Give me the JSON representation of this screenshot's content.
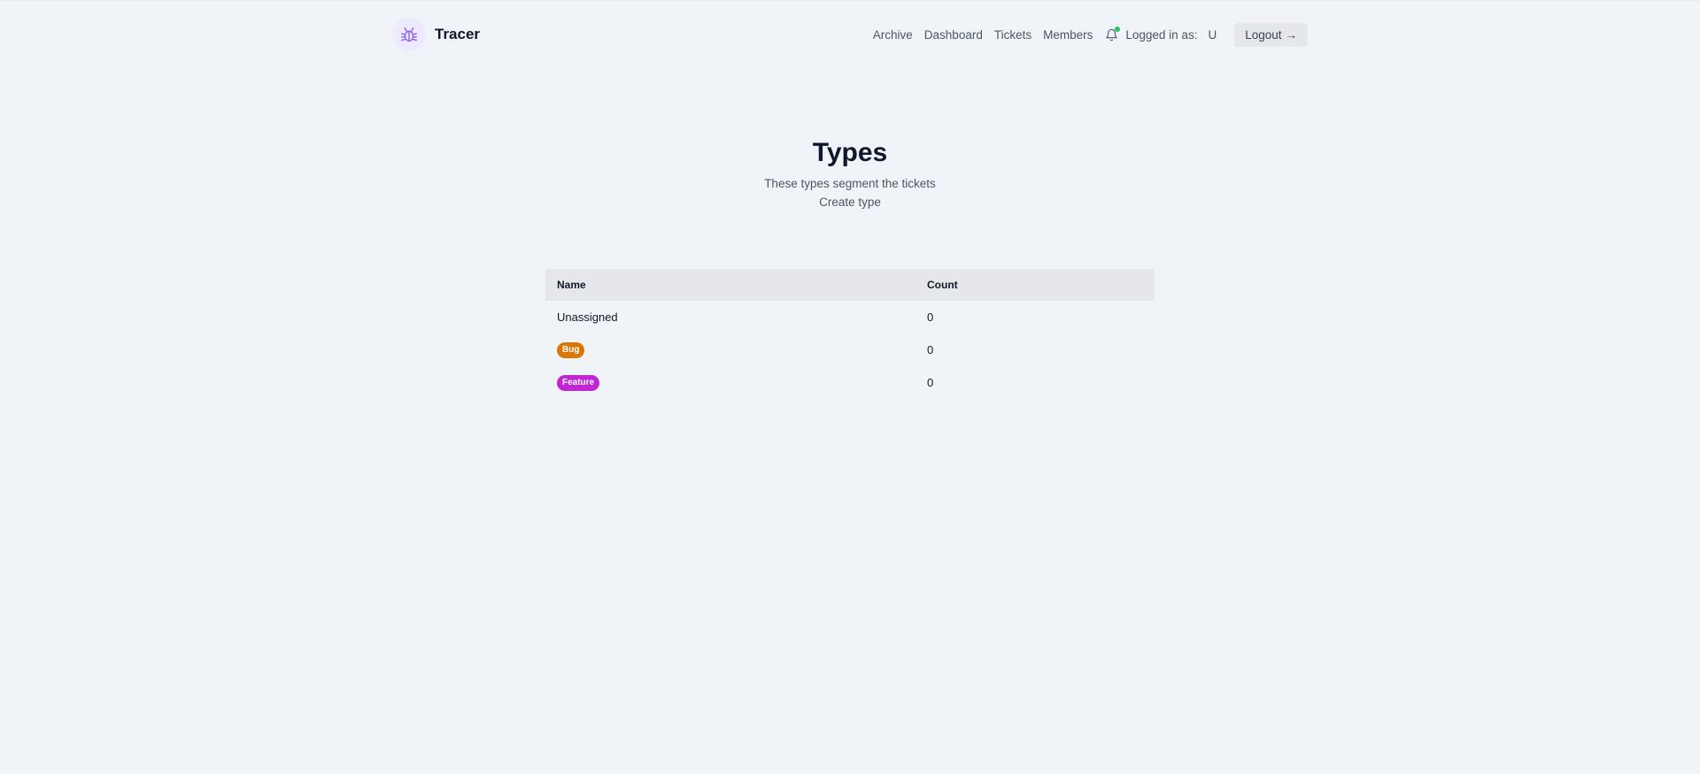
{
  "header": {
    "brand": "Tracer",
    "nav": [
      "Archive",
      "Dashboard",
      "Tickets",
      "Members"
    ],
    "logged_in_label": "Logged in as:",
    "logged_in_user": "U",
    "logout_label": "Logout",
    "logout_icon": "arrow-right-icon",
    "notification_icon": "bell-icon",
    "logo_icon": "bug-icon"
  },
  "main": {
    "title": "Types",
    "subtitle": "These types segment the tickets",
    "create_link": "Create type"
  },
  "table": {
    "columns": [
      "Name",
      "Count"
    ],
    "rows": [
      {
        "name": "Unassigned",
        "count": "0",
        "badge": false
      },
      {
        "name": "Bug",
        "count": "0",
        "badge": true,
        "color": "#d97706"
      },
      {
        "name": "Feature",
        "count": "0",
        "badge": true,
        "color": "#c026d3"
      }
    ]
  },
  "colors": {
    "background": "#f0f4f8",
    "notification_dot": "#22c55e",
    "logo_accent": "#8b5cf6"
  }
}
